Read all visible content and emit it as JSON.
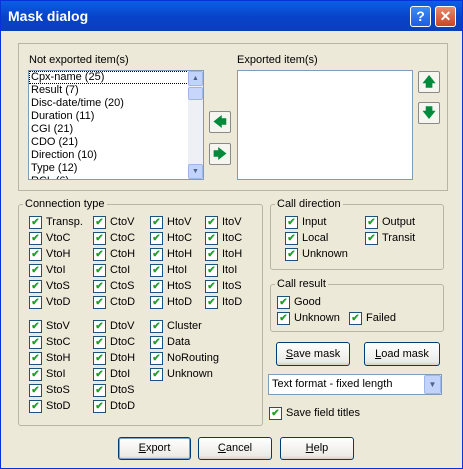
{
  "window": {
    "title": "Mask dialog",
    "help_glyph": "?",
    "close_glyph": "✕"
  },
  "not_exported": {
    "label": "Not exported item(s)",
    "items": [
      "Cpx-name  (25)",
      "Result  (7)",
      "Disc-date/time  (20)",
      "Duration (11)",
      "CGI  (21)",
      "CDO  (21)",
      "Direction  (10)",
      "Type  (12)",
      "RCL (6)"
    ]
  },
  "exported": {
    "label": "Exported item(s)",
    "items": []
  },
  "transfer": {
    "to_left": "🡄",
    "to_right": "🡆",
    "up": "🡅",
    "down": "🡇"
  },
  "connection_type": {
    "label": "Connection type",
    "items": [
      "Transp.",
      "CtoV",
      "HtoV",
      "ItoV",
      "VtoC",
      "CtoC",
      "HtoC",
      "ItoC",
      "VtoH",
      "CtoH",
      "HtoH",
      "ItoH",
      "VtoI",
      "CtoI",
      "HtoI",
      "ItoI",
      "VtoS",
      "CtoS",
      "HtoS",
      "ItoS",
      "VtoD",
      "CtoD",
      "HtoD",
      "ItoD",
      "StoV",
      "DtoV",
      "Cluster",
      "StoC",
      "DtoC",
      "Data",
      "StoH",
      "DtoH",
      "NoRouting",
      "StoI",
      "DtoI",
      "Unknown",
      "StoS",
      "DtoS",
      "StoD",
      "DtoD"
    ]
  },
  "call_direction": {
    "label": "Call direction",
    "items": [
      "Input",
      "Output",
      "Local",
      "Transit",
      "Unknown"
    ]
  },
  "call_result": {
    "label": "Call result",
    "items": [
      "Good",
      "Unknown",
      "Failed"
    ]
  },
  "buttons": {
    "save_mask": {
      "u": "S",
      "rest": "ave mask"
    },
    "load_mask": {
      "u": "L",
      "rest": "oad mask"
    },
    "export": {
      "u": "E",
      "rest": "xport"
    },
    "cancel": {
      "u": "C",
      "rest": "ancel"
    },
    "help": {
      "u": "H",
      "rest": "elp"
    }
  },
  "format": {
    "value": "Text format - fixed length"
  },
  "save_titles": {
    "label": "Save field titles"
  },
  "check_glyph": "✔",
  "colors": {
    "titlebar": "#0842c8",
    "dialog": "#ece9d8",
    "check": "#21a121"
  }
}
